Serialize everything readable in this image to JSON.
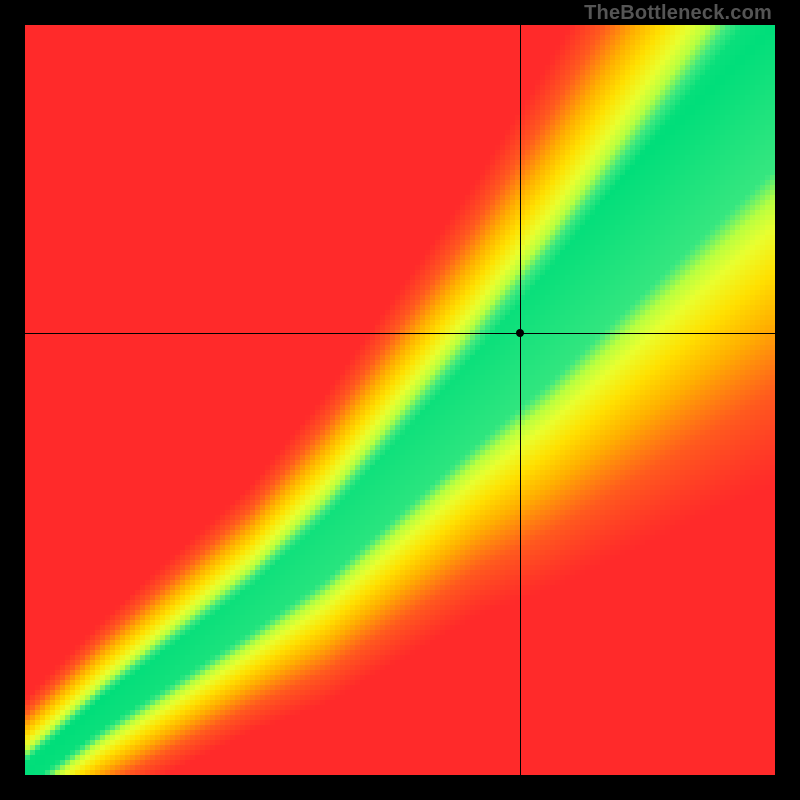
{
  "watermark": "TheBottleneck.com",
  "chart_data": {
    "type": "heatmap",
    "title": "",
    "xlabel": "",
    "ylabel": "",
    "xlim": [
      0,
      100
    ],
    "ylim": [
      0,
      100
    ],
    "crosshair": {
      "x": 66,
      "y": 59
    },
    "marker": {
      "x": 66,
      "y": 59
    },
    "color_scale": {
      "0.00": "#ff2a2a",
      "0.20": "#ff5a1e",
      "0.40": "#ffb000",
      "0.55": "#ffe000",
      "0.70": "#e8ff30",
      "0.80": "#b8ff40",
      "0.90": "#40e880",
      "1.00": "#00de7a"
    },
    "ridge": [
      {
        "x": 0,
        "y": 0,
        "half_width": 1.5
      },
      {
        "x": 10,
        "y": 8,
        "half_width": 2.0
      },
      {
        "x": 20,
        "y": 15,
        "half_width": 2.5
      },
      {
        "x": 30,
        "y": 22,
        "half_width": 3.0
      },
      {
        "x": 40,
        "y": 30,
        "half_width": 4.0
      },
      {
        "x": 50,
        "y": 40,
        "half_width": 5.0
      },
      {
        "x": 60,
        "y": 50,
        "half_width": 6.0
      },
      {
        "x": 70,
        "y": 60,
        "half_width": 7.5
      },
      {
        "x": 80,
        "y": 71,
        "half_width": 9.0
      },
      {
        "x": 90,
        "y": 82,
        "half_width": 10.5
      },
      {
        "x": 100,
        "y": 93,
        "half_width": 12.0
      }
    ],
    "background_gradient": {
      "description": "smooth field red→orange→yellow with optimal green band along ridge",
      "upper_left": "#ff2a2a",
      "lower_right": "#ff2a2a",
      "near_ridge": "#00de7a"
    }
  }
}
